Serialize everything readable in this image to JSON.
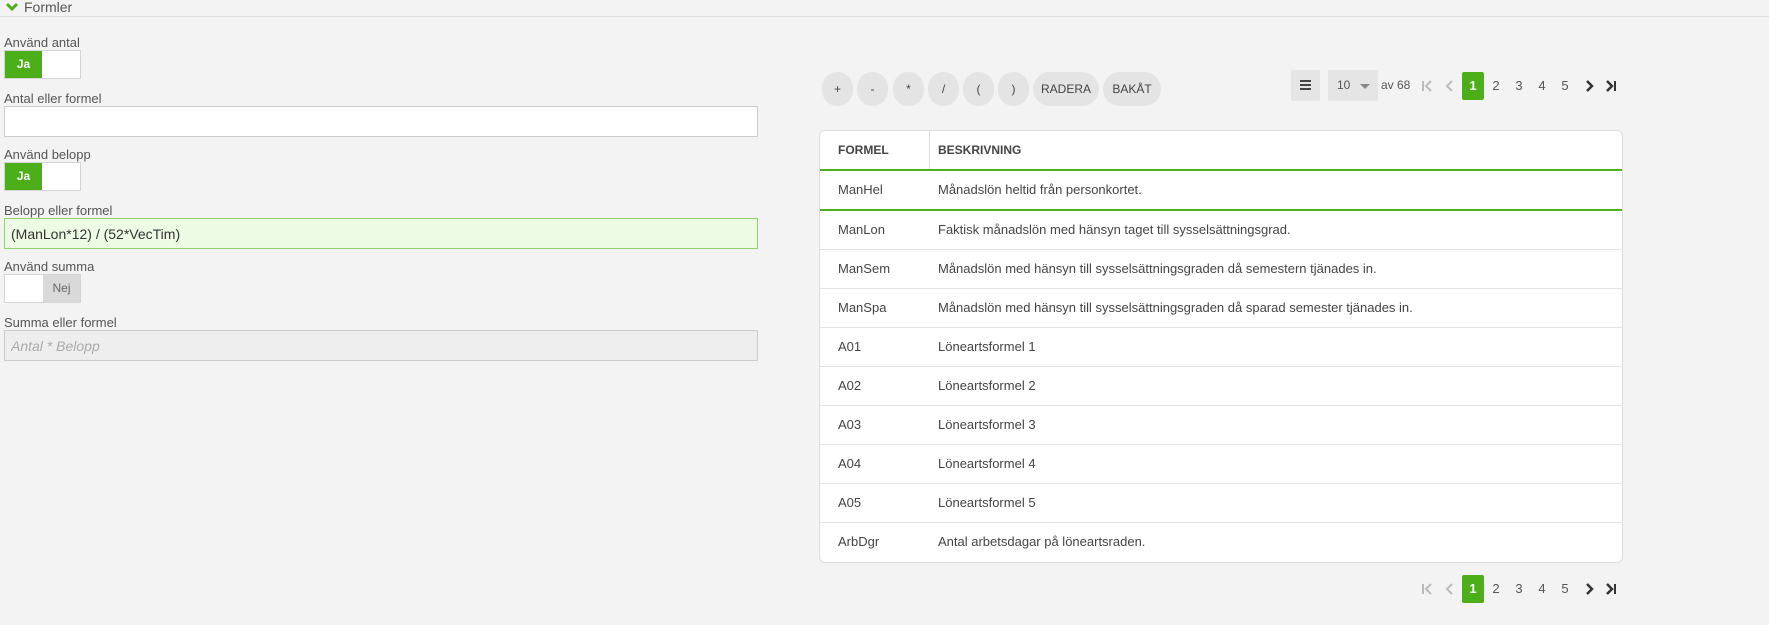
{
  "section": {
    "title": "Formler"
  },
  "fields": {
    "use_quantity": {
      "label": "Använd antal",
      "state": "Ja"
    },
    "quantity_formula": {
      "label": "Antal eller formel",
      "value": "",
      "placeholder": ""
    },
    "use_amount": {
      "label": "Använd belopp",
      "state": "Ja"
    },
    "amount_formula": {
      "label": "Belopp eller formel",
      "value": "(ManLon*12) / (52*VecTim)"
    },
    "use_sum": {
      "label": "Använd summa",
      "state": "Nej"
    },
    "sum_formula": {
      "label": "Summa eller formel",
      "placeholder": "Antal * Belopp"
    }
  },
  "operators": [
    "+",
    "-",
    "*",
    "/",
    "(",
    ")",
    "RADERA",
    "BAKÅT"
  ],
  "pager": {
    "page_size": "10",
    "of_text": "av 68",
    "pages": [
      "1",
      "2",
      "3",
      "4",
      "5"
    ],
    "current": "1"
  },
  "table": {
    "headers": {
      "formula": "FORMEL",
      "description": "BESKRIVNING"
    },
    "rows": [
      {
        "code": "ManHel",
        "desc": "Månadslön heltid från personkortet."
      },
      {
        "code": "ManLon",
        "desc": "Faktisk månadslön med hänsyn taget till sysselsättningsgrad."
      },
      {
        "code": "ManSem",
        "desc": "Månadslön med hänsyn till sysselsättningsgraden då semestern tjänades in."
      },
      {
        "code": "ManSpa",
        "desc": "Månadslön med hänsyn till sysselsättningsgraden då sparad semester tjänades in."
      },
      {
        "code": "A01",
        "desc": "Löneartsformel 1"
      },
      {
        "code": "A02",
        "desc": "Löneartsformel 2"
      },
      {
        "code": "A03",
        "desc": "Löneartsformel 3"
      },
      {
        "code": "A04",
        "desc": "Löneartsformel 4"
      },
      {
        "code": "A05",
        "desc": "Löneartsformel 5"
      },
      {
        "code": "ArbDgr",
        "desc": "Antal arbetsdagar på löneartsraden."
      }
    ]
  },
  "colors": {
    "accent": "#4caf1a",
    "active_input_bg": "#eefbe4"
  }
}
